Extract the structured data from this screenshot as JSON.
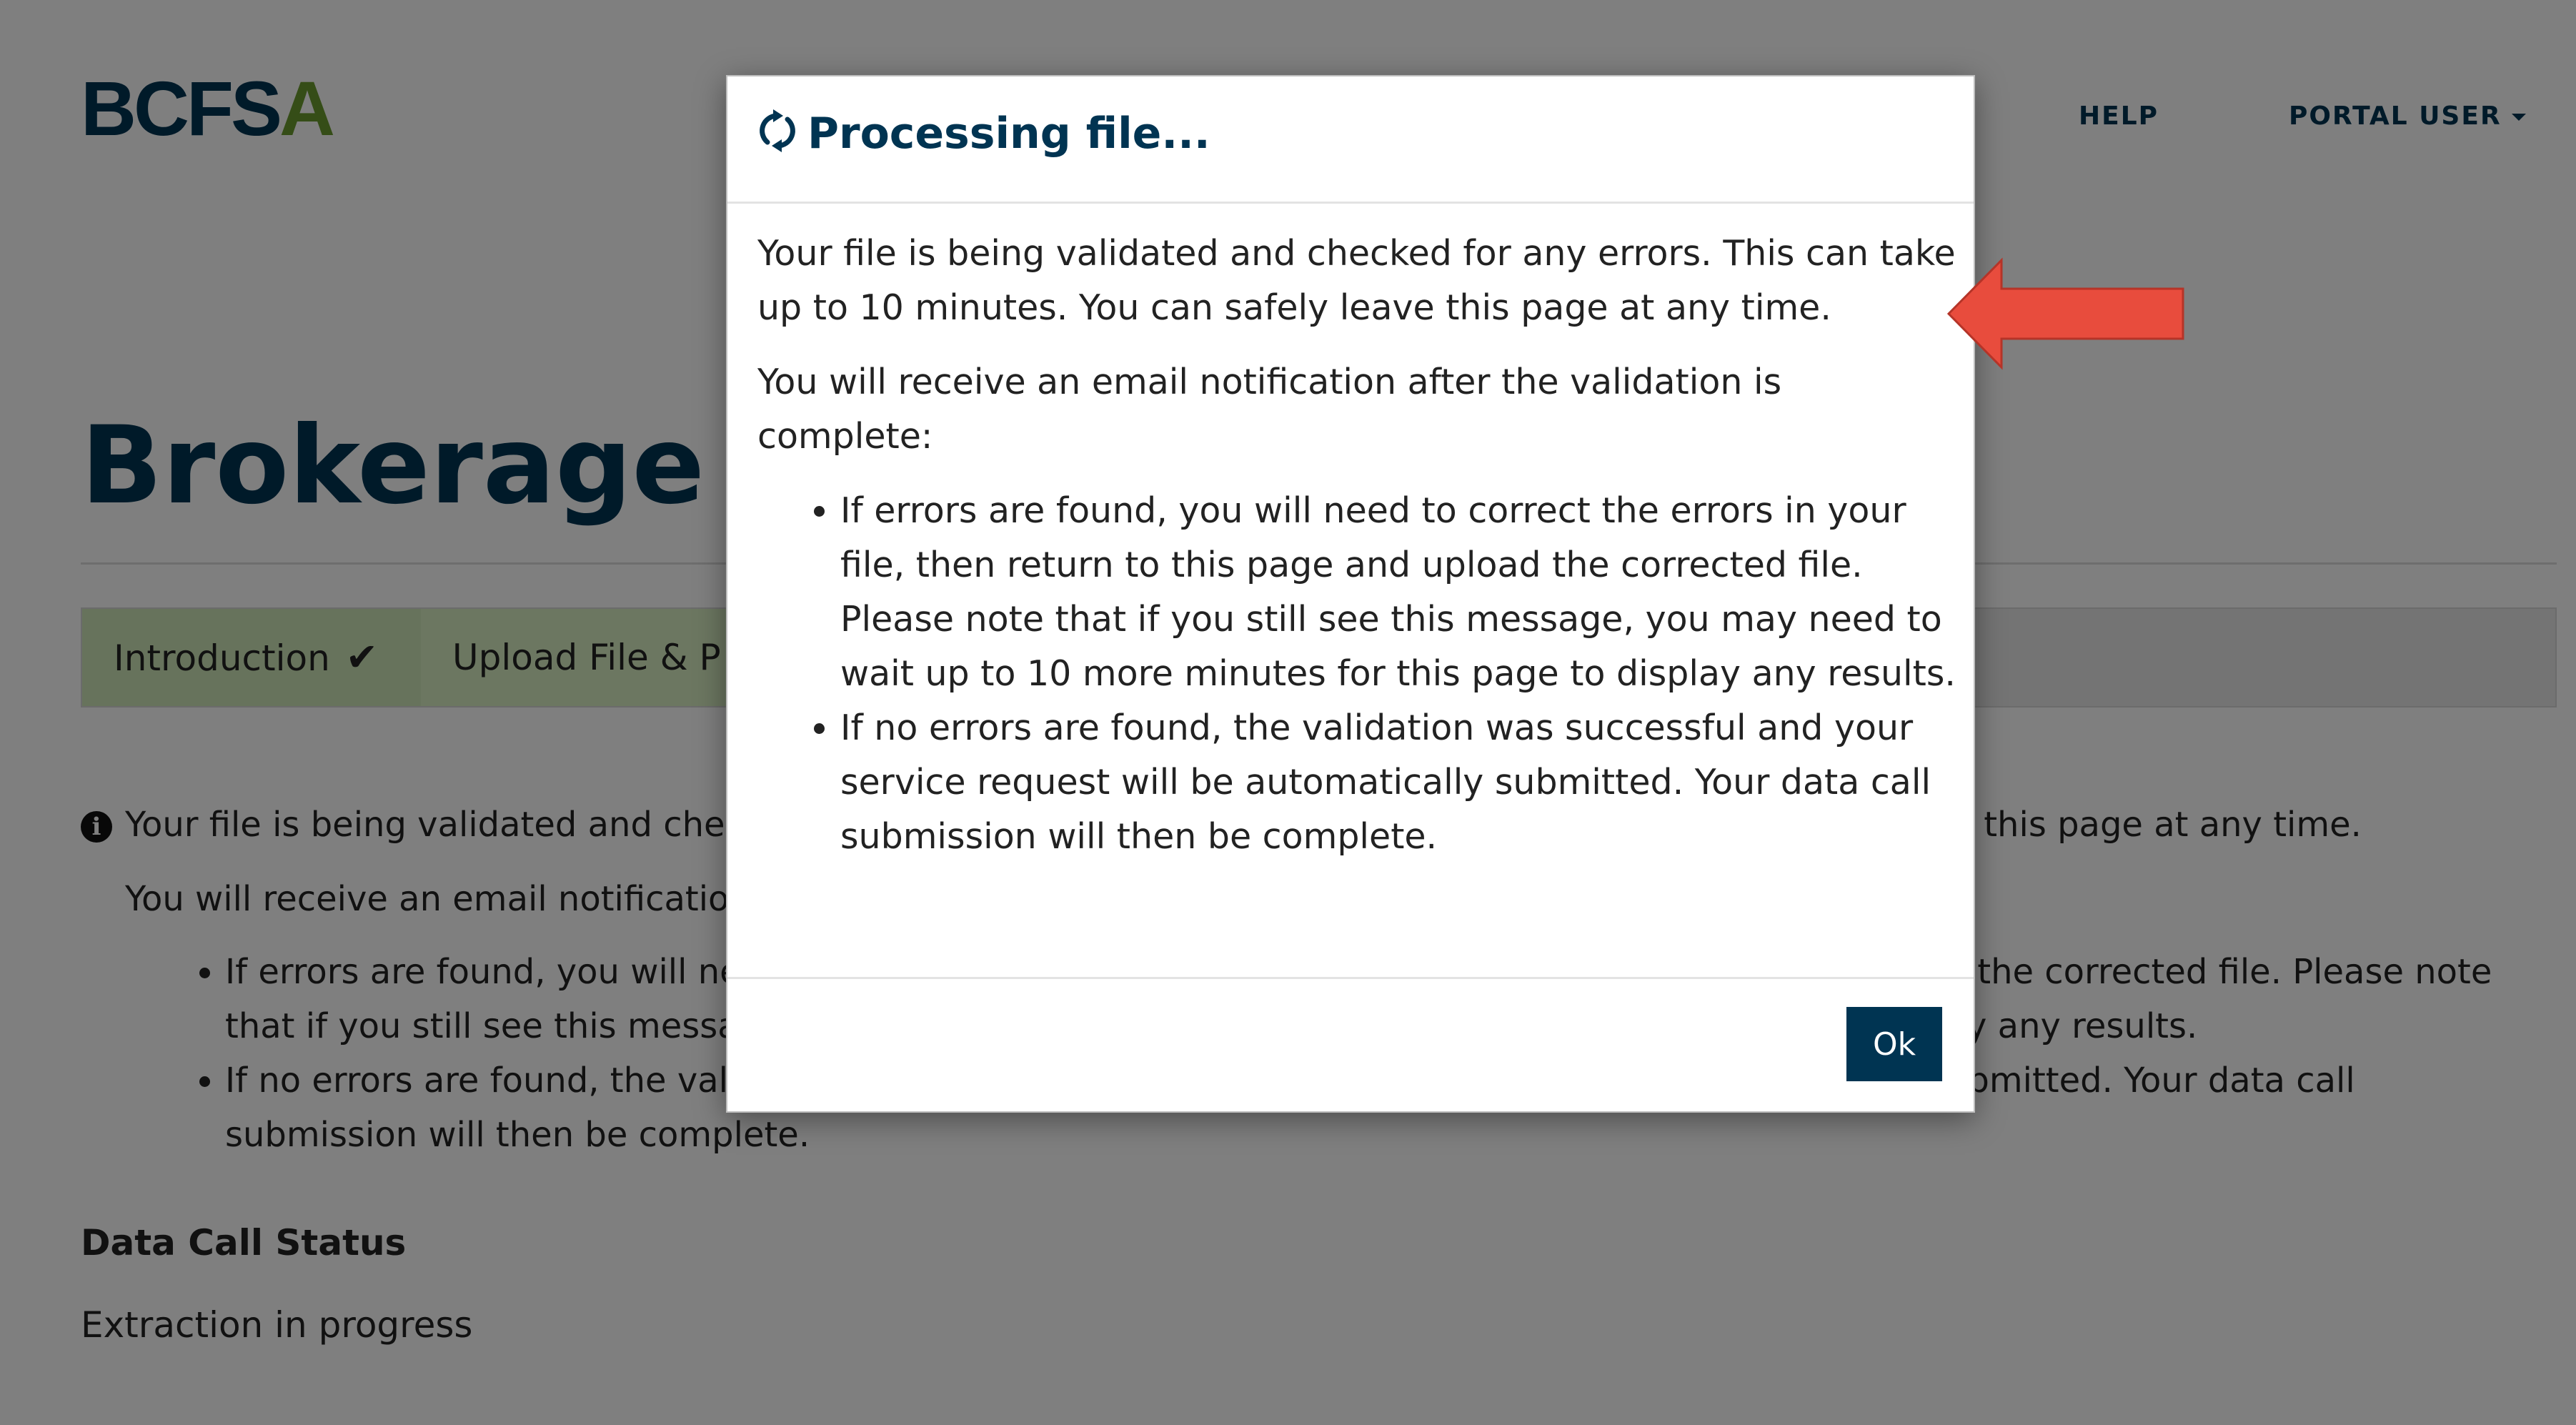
{
  "header": {
    "logo_main": "BCFS",
    "logo_accent": "A",
    "nav_help": "HELP",
    "nav_user": "PORTAL USER"
  },
  "page": {
    "title": "Brokerage Data Call"
  },
  "steps": [
    {
      "label": "Introduction",
      "check": "✔"
    },
    {
      "label": "Upload File & P"
    }
  ],
  "notice": {
    "info_icon_glyph": "i",
    "line1": "Your file is being validated and checked for any errors. This can take up to 10 minutes. You can safely leave this page at any time.",
    "line2": "You will receive an email notification after the validation is complete:",
    "bullets": [
      "If errors are found, you will need to correct the errors in your file, then return to this page and upload the corrected file. Please note that if you still see this message, you may need to wait up to 10 more minutes for this page to display any results.",
      "If no errors are found, the validation was successful and your service request will be automatically submitted. Your data call submission will then be complete."
    ]
  },
  "status": {
    "heading": "Data Call Status",
    "value": "Extraction in progress"
  },
  "modal": {
    "title": "Processing file...",
    "paragraph1": "Your file is being validated and checked for any errors. This can take up to 10 minutes. You can safely leave this page at any time.",
    "paragraph2": "You will receive an email notification after the validation is complete:",
    "bullets": [
      "If errors are found, you will need to correct the errors in your file, then return to this page and upload the corrected file. Please note that if you still see this message, you may need to wait up to 10 more minutes for this page to display any results.",
      "If no errors are found, the validation was successful and your service request will be automatically submitted. Your data call submission will then be complete."
    ],
    "ok_label": "Ok"
  },
  "colors": {
    "brand_navy": "#003452",
    "brand_green": "#6a9a2e",
    "step_active": "#cfe7b9",
    "annotation_arrow": "#e84c3d"
  },
  "icons": {
    "spinner": "refresh-icon",
    "info": "info-circle-icon",
    "check": "checkmark-icon",
    "annotation": "arrow-left-icon"
  }
}
